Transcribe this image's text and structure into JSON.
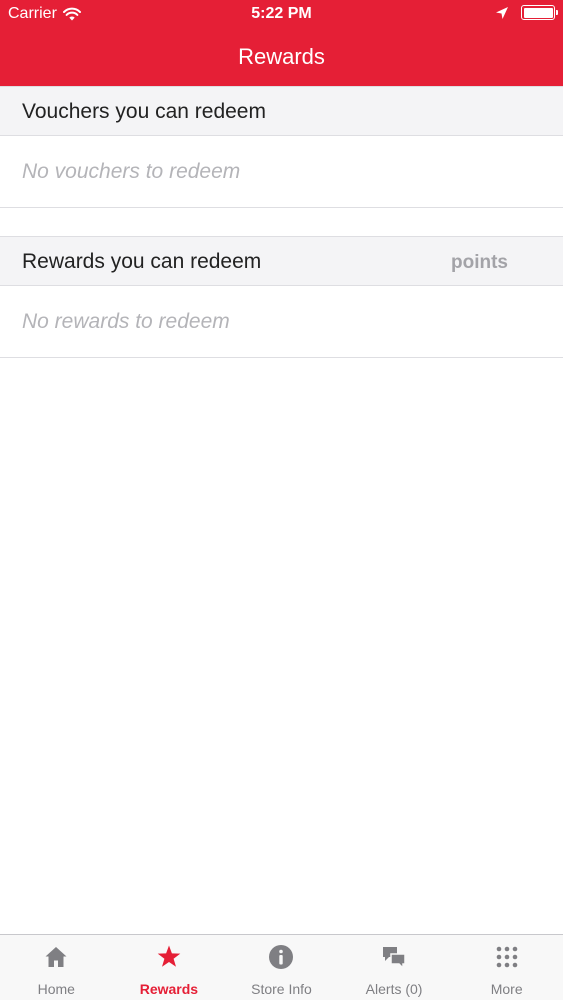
{
  "status_bar": {
    "carrier": "Carrier",
    "time": "5:22 PM"
  },
  "nav": {
    "title": "Rewards"
  },
  "vouchers": {
    "header": "Vouchers you can redeem",
    "empty": "No vouchers to redeem"
  },
  "rewards": {
    "header": "Rewards you can redeem",
    "points_label": "points",
    "empty": "No rewards to redeem"
  },
  "tabs": [
    {
      "label": "Home",
      "icon": "home-icon",
      "active": false
    },
    {
      "label": "Rewards",
      "icon": "star-icon",
      "active": true
    },
    {
      "label": "Store Info",
      "icon": "info-icon",
      "active": false
    },
    {
      "label": "Alerts (0)",
      "icon": "chat-bubbles-icon",
      "active": false
    },
    {
      "label": "More",
      "icon": "grid-dots-icon",
      "active": false
    }
  ],
  "colors": {
    "accent": "#e51f36",
    "tab_inactive": "#7f7f83"
  }
}
